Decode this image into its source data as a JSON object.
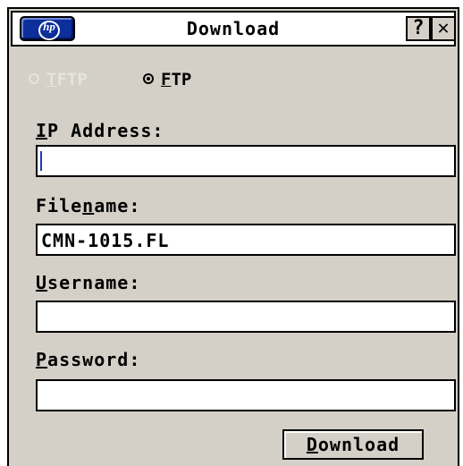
{
  "window": {
    "title": "Download",
    "logo_text": "hp",
    "help_label": "?",
    "close_label": "✕"
  },
  "protocol": {
    "options": [
      {
        "prefix": "",
        "mnemonic": "T",
        "rest": "FTP",
        "state": "disabled"
      },
      {
        "prefix": "",
        "mnemonic": "F",
        "rest": "TP",
        "state": "selected"
      }
    ]
  },
  "fields": {
    "ip_address": {
      "label_mnemonic": "I",
      "label_rest": "P Address:",
      "value": ""
    },
    "filename": {
      "label_prefix": "File",
      "label_mnemonic": "n",
      "label_rest": "ame:",
      "value": "CMN-1015.FL"
    },
    "username": {
      "label_mnemonic": "U",
      "label_rest": "sername:",
      "value": ""
    },
    "password": {
      "label_mnemonic": "P",
      "label_rest": "assword:",
      "value": ""
    }
  },
  "actions": {
    "download": {
      "mnemonic": "D",
      "rest": "ownload"
    }
  },
  "colors": {
    "dialog_bg": "#d4d0c8",
    "logo_blue": "#0c2f9c",
    "disabled_text": "#e6e4de",
    "caret": "#1a3bc4"
  }
}
